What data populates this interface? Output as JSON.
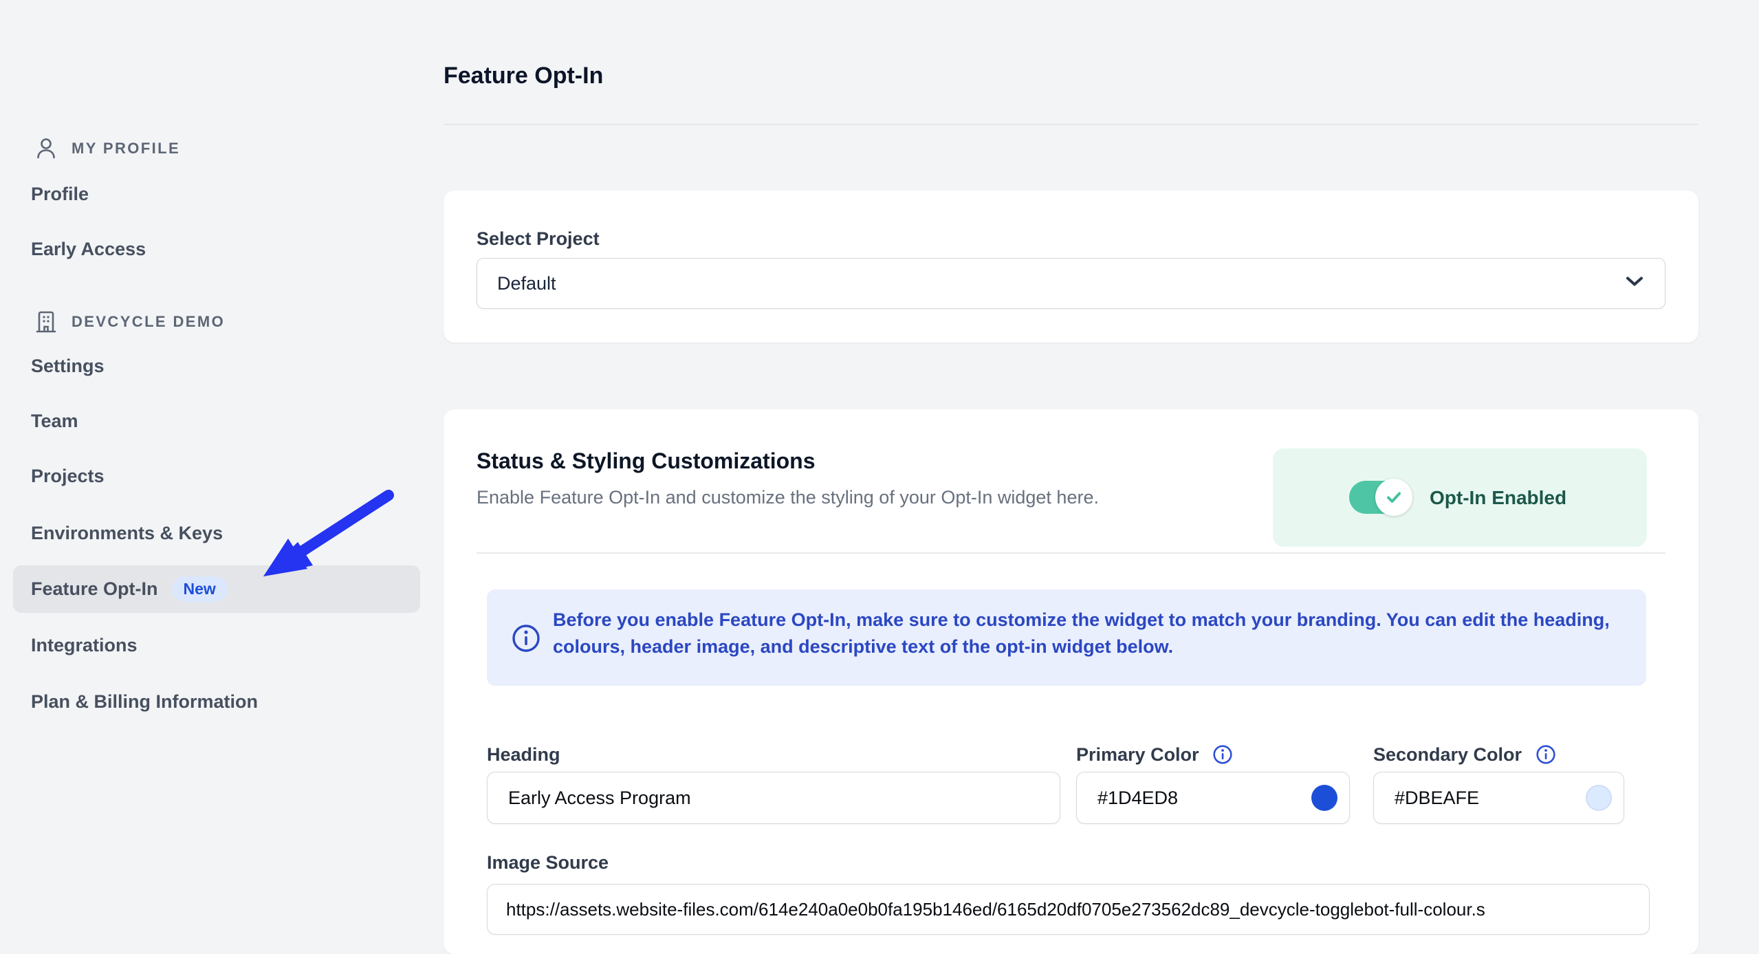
{
  "page": {
    "title": "Feature Opt-In"
  },
  "sidebar": {
    "sections": [
      {
        "label": "MY PROFILE",
        "icon": "person-icon",
        "items": [
          {
            "label": "Profile"
          },
          {
            "label": "Early Access"
          }
        ]
      },
      {
        "label": "DEVCYCLE DEMO",
        "icon": "building-icon",
        "items": [
          {
            "label": "Settings"
          },
          {
            "label": "Team"
          },
          {
            "label": "Projects"
          },
          {
            "label": "Environments & Keys"
          },
          {
            "label": "Feature Opt-In",
            "badge": "New",
            "active": true
          },
          {
            "label": "Integrations"
          },
          {
            "label": "Plan & Billing Information"
          }
        ]
      }
    ],
    "pointer_arrow_color": "#2434f1"
  },
  "project_card": {
    "label": "Select Project",
    "selected_option": "Default"
  },
  "status_card": {
    "title": "Status & Styling Customizations",
    "subtitle": "Enable Feature Opt-In and customize the styling of your Opt-In widget here.",
    "toggle": {
      "label": "Opt-In Enabled",
      "state": "on",
      "color": "#4ec6a5"
    },
    "banner": {
      "text": "Before you enable Feature Opt-In, make sure to customize the widget to match your branding. You can edit the heading, colours, header image, and descriptive text of the opt-in widget below.",
      "text_color": "#2b47c2",
      "background": "#e9effc"
    },
    "fields": {
      "heading": {
        "label": "Heading",
        "value": "Early Access Program"
      },
      "primary_color": {
        "label": "Primary Color",
        "value": "#1D4ED8",
        "swatch_style": "background:#1D4ED8"
      },
      "secondary_color": {
        "label": "Secondary Color",
        "value": "#DBEAFE",
        "swatch_style": "background:#DBEAFE;box-shadow:inset 0 0 0 2px #cfdef4"
      },
      "image_source": {
        "label": "Image Source",
        "value": "https://assets.website-files.com/614e240a0e0b0fa195b146ed/6165d20df0705e273562dc89_devcycle-togglebot-full-colour.s"
      }
    }
  }
}
